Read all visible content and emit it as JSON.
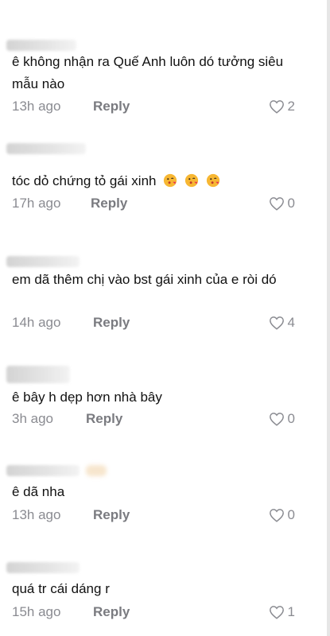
{
  "comments": [
    {
      "text": "ê không nhận ra Quế Anh luôn dó tưởng siêu mẫu nào",
      "time": "13h ago",
      "reply": "Reply",
      "likes": "2"
    },
    {
      "text": "tóc dỏ chứng tỏ gái xinh",
      "emojis": [
        "face-blowing-kiss",
        "face-blowing-kiss",
        "face-blowing-kiss"
      ],
      "time": "17h ago",
      "reply": "Reply",
      "likes": "0"
    },
    {
      "text": "em dã thêm chị vào bst gái xinh của e ròi dó",
      "time": "14h ago",
      "reply": "Reply",
      "likes": "4"
    },
    {
      "text": "ê bây h dẹp hơn nhà bây",
      "time": "3h ago",
      "reply": "Reply",
      "likes": "0"
    },
    {
      "text": "ê dã nha",
      "time": "13h ago",
      "reply": "Reply",
      "likes": "0"
    },
    {
      "text": "quá tr cái dáng r",
      "time": "15h ago",
      "reply": "Reply",
      "likes": "1"
    }
  ]
}
